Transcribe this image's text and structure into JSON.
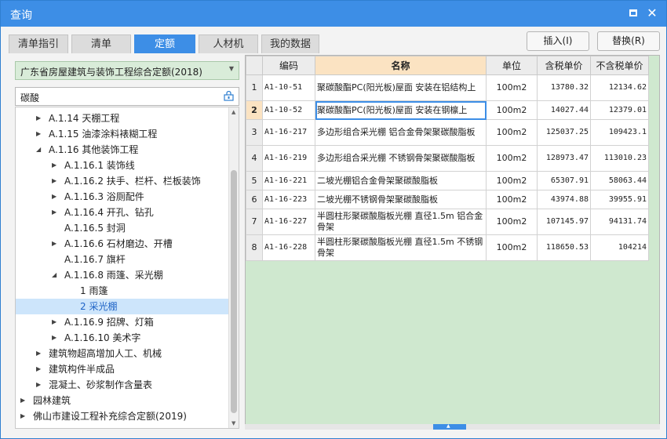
{
  "window": {
    "title": "查询"
  },
  "tabs": [
    {
      "label": "清单指引",
      "active": false
    },
    {
      "label": "清单",
      "active": false
    },
    {
      "label": "定额",
      "active": true
    },
    {
      "label": "人材机",
      "active": false
    },
    {
      "label": "我的数据",
      "active": false
    }
  ],
  "actions": {
    "insert_label": "插入(I)",
    "replace_label": "替换(R)"
  },
  "left": {
    "library_selected": "广东省房屋建筑与装饰工程综合定额(2018)",
    "search_value": "碳酸"
  },
  "tree": [
    {
      "label": "A.1.14 天棚工程",
      "level": 1,
      "expander": "collapsed",
      "selected": false
    },
    {
      "label": "A.1.15 油漆涂料裱糊工程",
      "level": 1,
      "expander": "collapsed",
      "selected": false
    },
    {
      "label": "A.1.16 其他装饰工程",
      "level": 1,
      "expander": "expanded",
      "selected": false
    },
    {
      "label": "A.1.16.1 装饰线",
      "level": 2,
      "expander": "collapsed",
      "selected": false
    },
    {
      "label": "A.1.16.2 扶手、栏杆、栏板装饰",
      "level": 2,
      "expander": "collapsed",
      "selected": false
    },
    {
      "label": "A.1.16.3 浴厕配件",
      "level": 2,
      "expander": "collapsed",
      "selected": false
    },
    {
      "label": "A.1.16.4 开孔、钻孔",
      "level": 2,
      "expander": "collapsed",
      "selected": false
    },
    {
      "label": "A.1.16.5 封洞",
      "level": 2,
      "expander": "none",
      "selected": false
    },
    {
      "label": "A.1.16.6 石材磨边、开槽",
      "level": 2,
      "expander": "collapsed",
      "selected": false
    },
    {
      "label": "A.1.16.7 旗杆",
      "level": 2,
      "expander": "none",
      "selected": false
    },
    {
      "label": "A.1.16.8 雨篷、采光棚",
      "level": 2,
      "expander": "expanded",
      "selected": false
    },
    {
      "label": "1 雨篷",
      "level": 3,
      "expander": "none",
      "selected": false
    },
    {
      "label": "2 采光棚",
      "level": 3,
      "expander": "none",
      "selected": true
    },
    {
      "label": "A.1.16.9 招牌、灯箱",
      "level": 2,
      "expander": "collapsed",
      "selected": false
    },
    {
      "label": "A.1.16.10 美术字",
      "level": 2,
      "expander": "collapsed",
      "selected": false
    },
    {
      "label": "建筑物超高增加人工、机械",
      "level": 1,
      "expander": "collapsed",
      "selected": false
    },
    {
      "label": "建筑构件半成品",
      "level": 1,
      "expander": "collapsed",
      "selected": false
    },
    {
      "label": "混凝土、砂浆制作含量表",
      "level": 1,
      "expander": "collapsed",
      "selected": false
    },
    {
      "label": "园林建筑",
      "level": 0,
      "expander": "collapsed",
      "selected": false
    },
    {
      "label": "佛山市建设工程补充综合定额(2019)",
      "level": 0,
      "expander": "collapsed",
      "selected": false
    }
  ],
  "grid": {
    "headers": {
      "code": "编码",
      "name": "名称",
      "unit": "单位",
      "price_tax": "含税单价",
      "price_notax": "不含税单价"
    },
    "rows": [
      {
        "no": "1",
        "code": "A1-10-51",
        "name": "聚碳酸酯PC(阳光板)屋面 安装在铝结构上",
        "unit": "100m2",
        "price_tax": "13780.32",
        "price_notax": "12134.62"
      },
      {
        "no": "2",
        "code": "A1-10-52",
        "name": "聚碳酸酯PC(阳光板)屋面 安装在钢檩上",
        "unit": "100m2",
        "price_tax": "14027.44",
        "price_notax": "12379.01"
      },
      {
        "no": "3",
        "code": "A1-16-217",
        "name": "多边形组合采光棚 铝合金骨架聚碳酸脂板",
        "unit": "100m2",
        "price_tax": "125037.25",
        "price_notax": "109423.1"
      },
      {
        "no": "4",
        "code": "A1-16-219",
        "name": "多边形组合采光棚 不锈钢骨架聚碳酸脂板",
        "unit": "100m2",
        "price_tax": "128973.47",
        "price_notax": "113010.23"
      },
      {
        "no": "5",
        "code": "A1-16-221",
        "name": "二坡光棚铝合金骨架聚碳酸脂板",
        "unit": "100m2",
        "price_tax": "65307.91",
        "price_notax": "58063.44"
      },
      {
        "no": "6",
        "code": "A1-16-223",
        "name": "二坡光棚不锈钢骨架聚碳酸脂板",
        "unit": "100m2",
        "price_tax": "43974.88",
        "price_notax": "39955.91"
      },
      {
        "no": "7",
        "code": "A1-16-227",
        "name": "半圆柱形聚碳酸脂板光棚 直径1.5m 铝合金骨架",
        "unit": "100m2",
        "price_tax": "107145.97",
        "price_notax": "94131.74"
      },
      {
        "no": "8",
        "code": "A1-16-228",
        "name": "半圆柱形聚碳酸脂板光棚 直径1.5m 不锈钢骨架",
        "unit": "100m2",
        "price_tax": "118650.53",
        "price_notax": "104214"
      }
    ],
    "current_row": "2"
  }
}
